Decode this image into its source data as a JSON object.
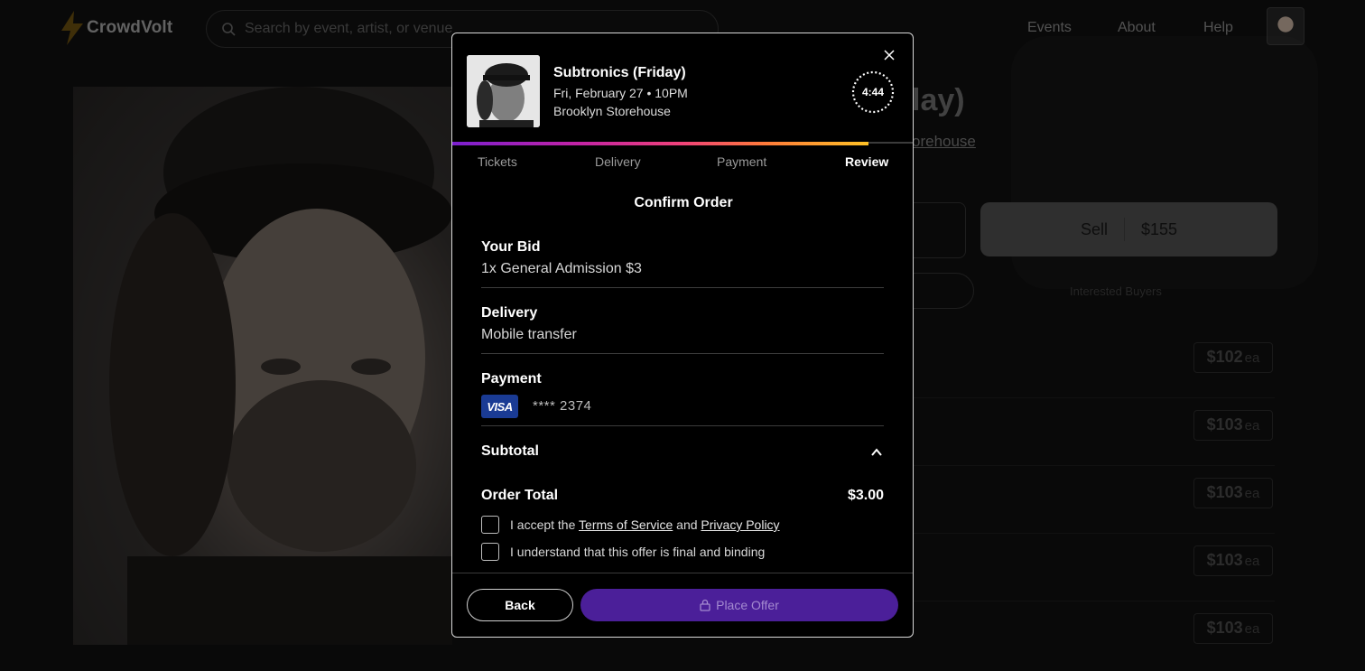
{
  "app": {
    "brand": "CrowdVolt",
    "search_placeholder": "Search by event, artist, or venue",
    "nav": [
      "Events",
      "About",
      "Help"
    ]
  },
  "background": {
    "title_fragment": "lay)",
    "venue_fragment": "orehouse",
    "sell_label": "Sell",
    "sell_price": "$155",
    "interested_label": "Interested Buyers",
    "prices": [
      {
        "amount": "$102",
        "unit": "ea"
      },
      {
        "amount": "$103",
        "unit": "ea"
      },
      {
        "amount": "$103",
        "unit": "ea"
      },
      {
        "amount": "$103",
        "unit": "ea"
      },
      {
        "amount": "$103",
        "unit": "ea"
      }
    ]
  },
  "modal": {
    "event": {
      "title": "Subtronics (Friday)",
      "date": "Fri, February 27 • 10PM",
      "venue": "Brooklyn Storehouse"
    },
    "timer": "4:44",
    "progress_fraction": 0.9,
    "steps": [
      {
        "label": "Tickets",
        "active": false
      },
      {
        "label": "Delivery",
        "active": false
      },
      {
        "label": "Payment",
        "active": false
      },
      {
        "label": "Review",
        "active": true
      }
    ],
    "heading": "Confirm Order",
    "bid": {
      "label": "Your Bid",
      "value": "1x General Admission $3"
    },
    "delivery": {
      "label": "Delivery",
      "value": "Mobile transfer"
    },
    "payment": {
      "label": "Payment",
      "card_brand": "VISA",
      "card_number": "**** 2374"
    },
    "subtotal_label": "Subtotal",
    "order_total": {
      "label": "Order Total",
      "value": "$3.00"
    },
    "terms": {
      "prefix": "I accept the",
      "tos": "Terms of Service",
      "and": "and",
      "privacy": "Privacy Policy",
      "binding": "I understand that this offer is final and binding"
    },
    "buttons": {
      "back": "Back",
      "place": "Place Offer"
    },
    "colors": {
      "accent": "#4b1f99",
      "visa": "#1a3b94"
    }
  }
}
